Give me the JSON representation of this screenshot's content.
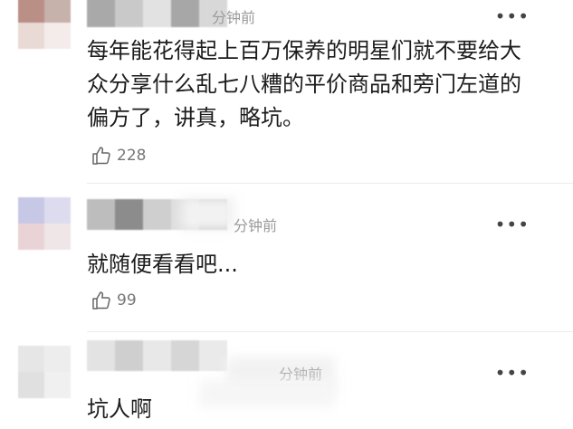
{
  "comments": [
    {
      "time": "分钟前",
      "more": "•••",
      "text": "每年能花得起上百万保养的明星们就不要给大众分享什么乱七八糟的平价商品和旁门左道的偏方了，讲真，略坑。",
      "likes": "228",
      "avatar_colors": [
        "#b98f86",
        "#c7b1ab",
        "#e9dad6",
        "#f3ecea"
      ],
      "name_colors": [
        "#a9a9a9",
        "#c9c9c9",
        "#e2e2e2",
        "#a7a7a7",
        "#d8d8d8"
      ]
    },
    {
      "time": "分钟前",
      "more": "•••",
      "text": "就随便看看吧...",
      "likes": "99",
      "avatar_colors": [
        "#c7c7e6",
        "#dcdcee",
        "#ead3d6",
        "#efe6e8"
      ],
      "name_colors": [
        "#bdbdbd",
        "#8c8c8c",
        "#cfcfcf",
        "#dedede",
        "#c4c4c4"
      ]
    },
    {
      "time": "分钟前",
      "more": "•••",
      "text": "坑人啊",
      "avatar_colors": [
        "#e6e6e6",
        "#ededed",
        "#e0e0e0",
        "#f0f0f0"
      ],
      "name_colors": [
        "#e3e3e3",
        "#cfcfcf",
        "#e8e8e8",
        "#d6d6d6",
        "#eaeaea"
      ]
    }
  ]
}
